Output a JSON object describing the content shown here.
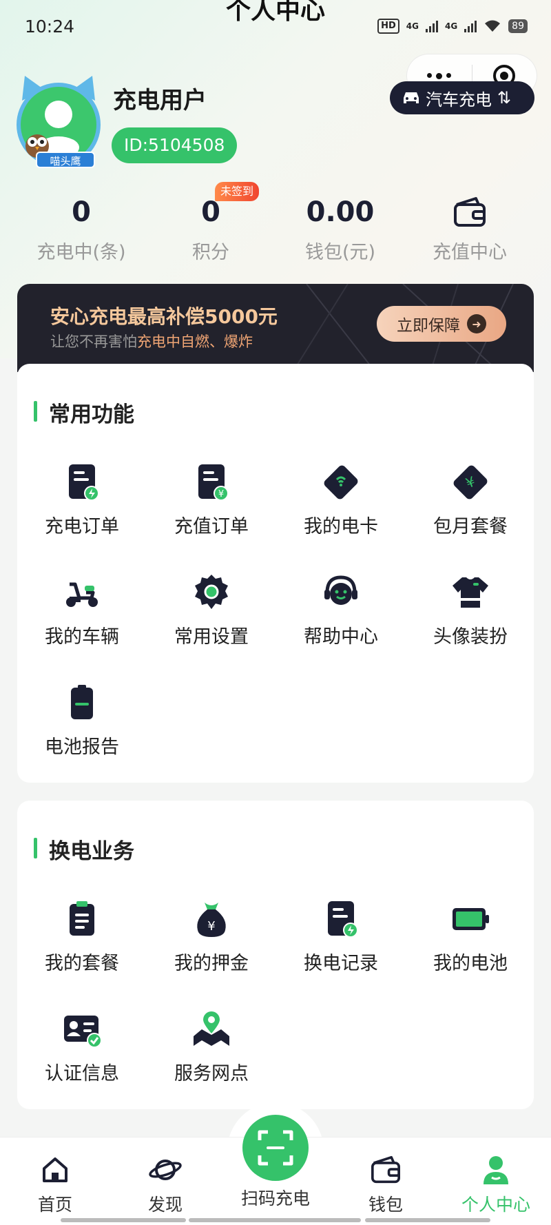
{
  "status_bar": {
    "time": "10:24",
    "hd": "HD",
    "net1": "4G",
    "net2": "4G",
    "battery": "89"
  },
  "header": {
    "title": "个人中心",
    "car_button": "汽车充电"
  },
  "user": {
    "name": "充电用户",
    "id": "ID:5104508",
    "avatar_tag": "喵头鹰"
  },
  "stats": [
    {
      "value": "0",
      "label": "充电中(条)"
    },
    {
      "value": "0",
      "label": "积分",
      "badge": "未签到"
    },
    {
      "value": "0.00",
      "label": "钱包(元)"
    },
    {
      "label": "充值中心",
      "icon": "wallet-icon"
    }
  ],
  "banner": {
    "title": "安心充电最高补偿5000元",
    "subtitle_prefix": "让您不再害怕",
    "subtitle_highlight": "充电中自燃、爆炸",
    "button": "立即保障"
  },
  "common_functions": {
    "title": "常用功能",
    "items": [
      {
        "label": "充电订单",
        "icon": "charge-order-icon"
      },
      {
        "label": "充值订单",
        "icon": "recharge-order-icon"
      },
      {
        "label": "我的电卡",
        "icon": "card-icon"
      },
      {
        "label": "包月套餐",
        "icon": "monthly-package-icon"
      },
      {
        "label": "我的车辆",
        "icon": "scooter-icon"
      },
      {
        "label": "常用设置",
        "icon": "settings-icon"
      },
      {
        "label": "帮助中心",
        "icon": "help-icon"
      },
      {
        "label": "头像装扮",
        "icon": "avatar-dress-icon"
      },
      {
        "label": "电池报告",
        "icon": "battery-report-icon"
      }
    ]
  },
  "swap_business": {
    "title": "换电业务",
    "items": [
      {
        "label": "我的套餐",
        "icon": "package-icon"
      },
      {
        "label": "我的押金",
        "icon": "deposit-icon"
      },
      {
        "label": "换电记录",
        "icon": "swap-record-icon"
      },
      {
        "label": "我的电池",
        "icon": "battery-icon"
      },
      {
        "label": "认证信息",
        "icon": "verification-icon"
      },
      {
        "label": "服务网点",
        "icon": "service-point-icon"
      }
    ]
  },
  "tabbar": {
    "items": [
      {
        "label": "首页",
        "icon": "home-icon"
      },
      {
        "label": "发现",
        "icon": "planet-icon"
      },
      {
        "label": "扫码充电",
        "icon": "scan-icon"
      },
      {
        "label": "钱包",
        "icon": "wallet-icon"
      },
      {
        "label": "个人中心",
        "icon": "user-icon",
        "active": true
      }
    ]
  },
  "colors": {
    "brand_green": "#35c26a",
    "dark_navy": "#1c1f33",
    "banner_gold": "#f5c89c"
  }
}
